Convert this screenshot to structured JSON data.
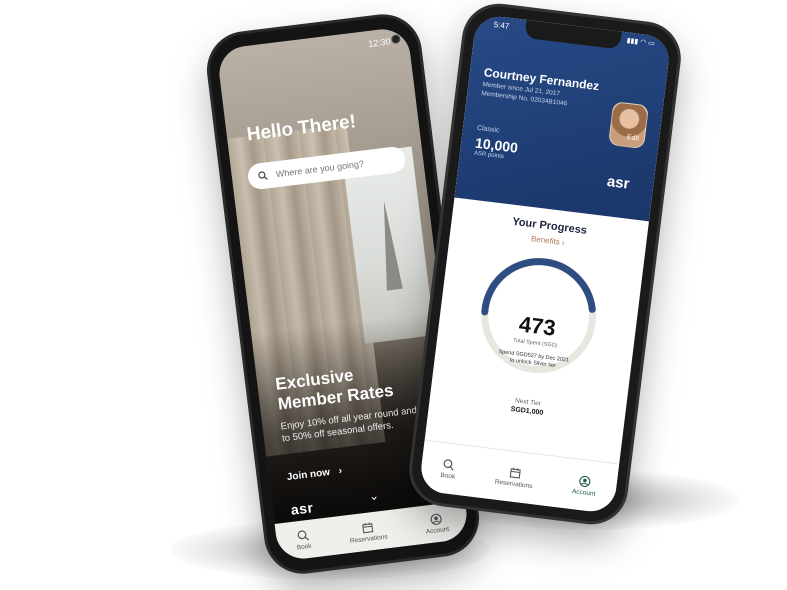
{
  "left_phone": {
    "status_time": "12:30",
    "greeting": "Hello There!",
    "search": {
      "placeholder": "Where are you going?"
    },
    "promo": {
      "title_line1": "Exclusive",
      "title_line2": "Member Rates",
      "text": "Enjoy 10% off all year round and up to 50% off seasonal offers.",
      "cta": "Join now",
      "cta_arrow": "›",
      "scroll_indicator": "⌄"
    },
    "logo": "asr",
    "nav": {
      "book": "Book",
      "reservations": "Reservations",
      "account": "Account"
    }
  },
  "right_phone": {
    "status_time": "5:47",
    "status_icons": "▮▮▮ ◠ ▭",
    "card": {
      "name": "Courtney Fernandez",
      "member_since": "Member since Jul 21, 2017",
      "membership": "Membership No. 02034B1046",
      "edit": "Edit",
      "tier": "Classic",
      "points": "10,000",
      "points_label": "ASR points",
      "logo": "asr"
    },
    "progress": {
      "title": "Your Progress",
      "benefits": "Benefits ›",
      "value": "473",
      "value_label": "Total Spent (SGD)",
      "note_line1": "Spend SGD527 by Dec 2021",
      "note_line2": "to unlock Silver tier",
      "fraction": 0.47,
      "next_tier_label": "Next Tier",
      "next_tier_amount": "SGD1,000"
    },
    "nav": {
      "book": "Book",
      "reservations": "Reservations",
      "account": "Account"
    },
    "colors": {
      "card": "#274a86",
      "gauge": "#2e4d82",
      "gauge_track": "#e7e6df",
      "accent": "#1f5b4d",
      "benefits": "#b07a52"
    }
  }
}
